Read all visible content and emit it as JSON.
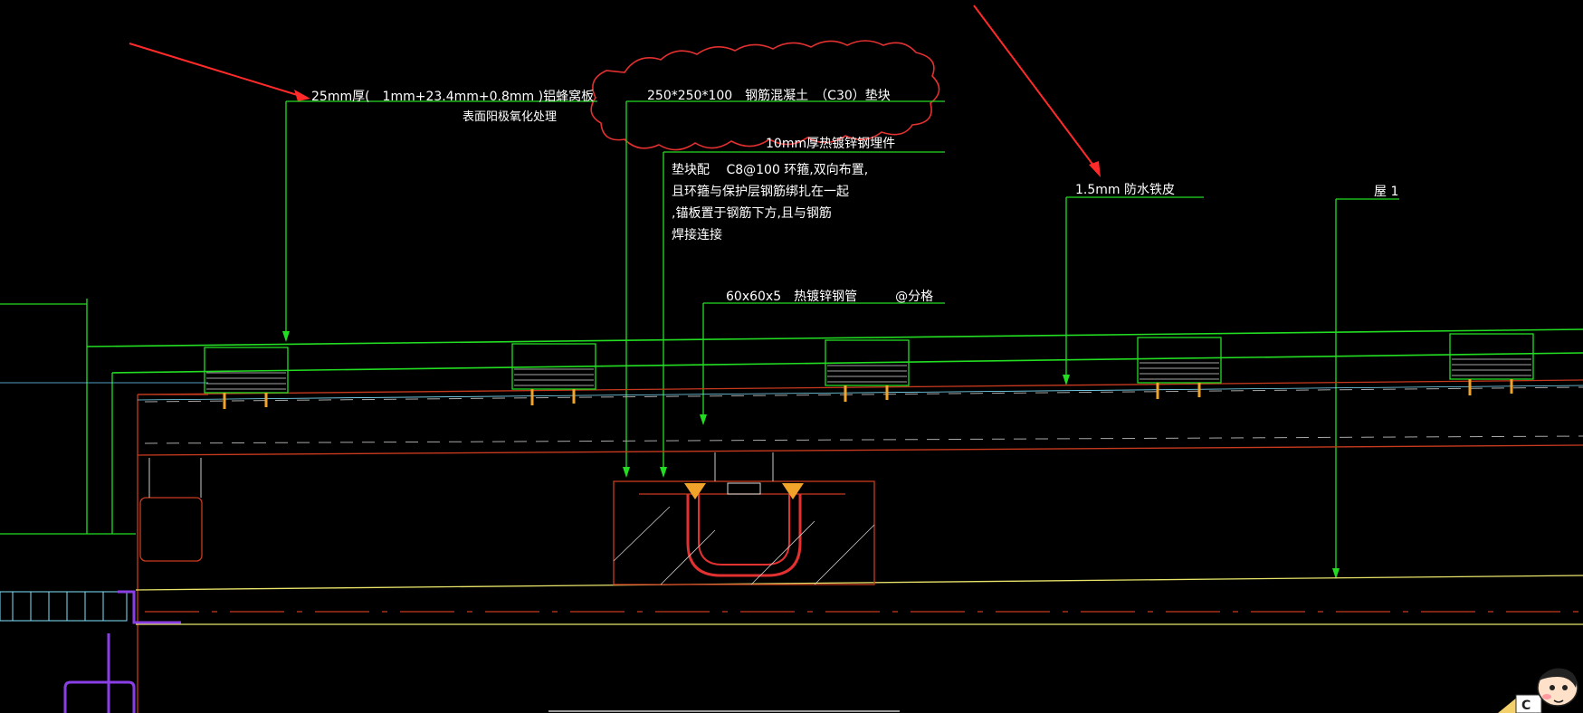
{
  "canvas": {
    "background": "#000000"
  },
  "colors": {
    "leader": "#22dd22",
    "structure_red": "#c83a1e",
    "slab_line": "#e9e56a",
    "cloud": "#e33030",
    "arrow": "#ff2a2a",
    "anchor": "#f1a32a",
    "purple": "#8a3fe6",
    "cyan": "#7fe3ff",
    "dashed": "#a8a8a8"
  },
  "annotations": {
    "panel_line1": "25mm厚(　1mm+23.4mm+0.8mm )铝蜂窝板",
    "panel_line2": "表面阳极氧化处理",
    "block_spec": "250*250*100　钢筋混凝土　（C30）垫块",
    "embed_plate": "10mm厚热镀锌钢埋件",
    "rebar_line1": "垫块配　 C8@100 环箍,双向布置,",
    "rebar_line2": "且环箍与保护层钢筋绑扎在一起",
    "rebar_line3": ",锚板置于钢筋下方,且与钢筋",
    "rebar_line4": "焊接连接",
    "tube": "60x60x5　热镀锌钢管　　　@分格",
    "waterproof": "1.5mm 防水铁皮",
    "roof": "屋 1"
  },
  "icons": {
    "mascot": "cartoon-character-icon"
  }
}
